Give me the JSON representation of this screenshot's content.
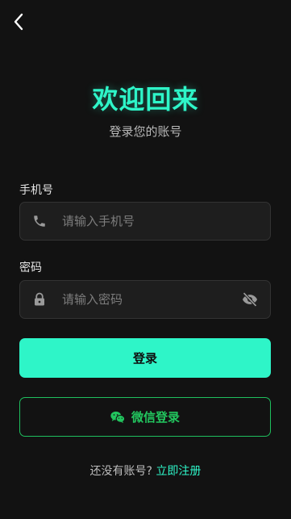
{
  "header": {
    "back_icon": "chevron-left-icon"
  },
  "hero": {
    "title": "欢迎回来",
    "subtitle": "登录您的账号"
  },
  "form": {
    "phone": {
      "label": "手机号",
      "placeholder": "请输入手机号",
      "value": "",
      "icon": "phone-icon"
    },
    "password": {
      "label": "密码",
      "placeholder": "请输入密码",
      "value": "",
      "icon": "lock-icon",
      "toggle_icon": "eye-off-icon"
    }
  },
  "actions": {
    "login_label": "登录",
    "wechat_label": "微信登录",
    "wechat_icon": "wechat-icon"
  },
  "footer": {
    "prompt": "还没有账号?",
    "register_link": "立即注册"
  },
  "colors": {
    "accent": "#2ef5c8",
    "wechat": "#22c55e",
    "background": "#121212"
  }
}
